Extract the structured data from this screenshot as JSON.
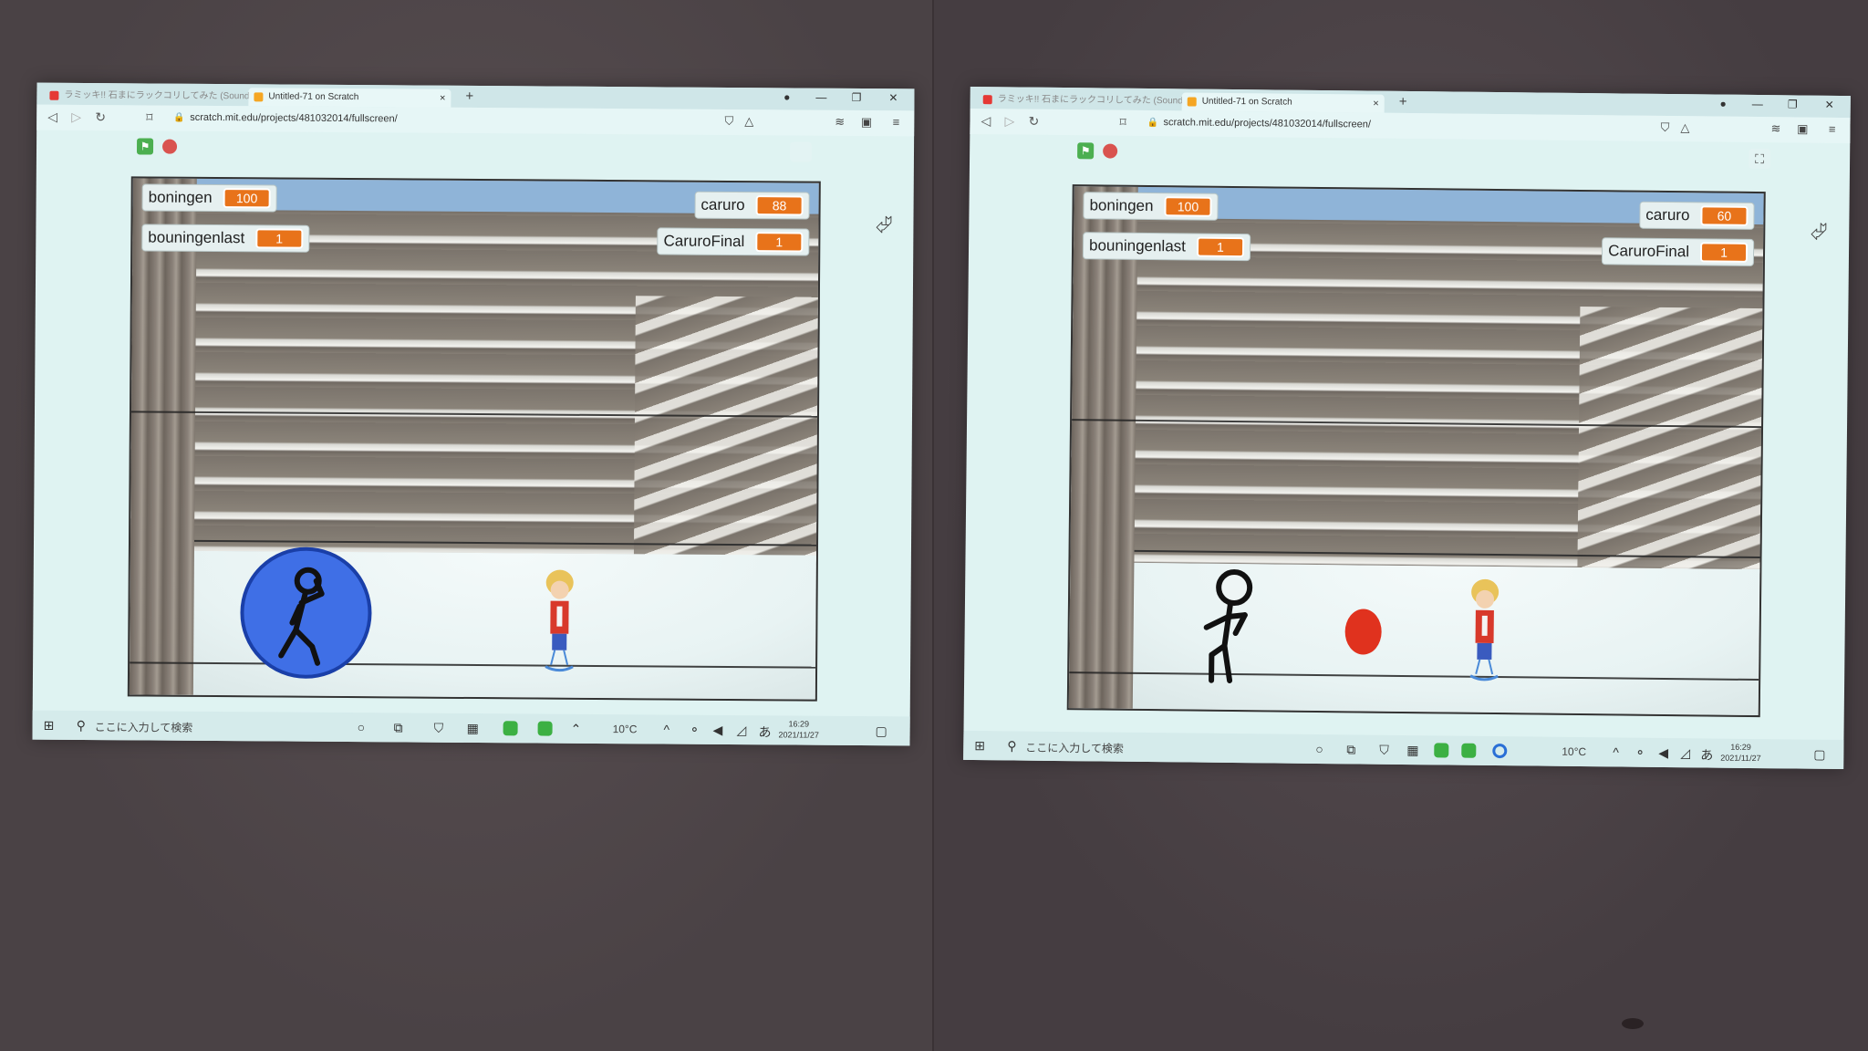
{
  "panels": [
    {
      "tabs": [
        "ラミッキ!! 石まにラックコリしてみた (Sound)...",
        "Untitled-71 on Scratch"
      ],
      "new_tab": "+",
      "url": "scratch.mit.edu/projects/481032014/fullscreen/",
      "monitors": {
        "boningen": {
          "label": "boningen",
          "value": "100"
        },
        "bouningenlast": {
          "label": "bouningenlast",
          "value": "1"
        },
        "caruro": {
          "label": "caruro",
          "value": "88"
        },
        "caruroFinal": {
          "label": "CaruroFinal",
          "value": "1"
        }
      },
      "taskbar": {
        "search_placeholder": "ここに入力して検索",
        "temperature": "10°C",
        "time": "16:29",
        "date": "2021/11/27"
      },
      "stickman_in_shield": true,
      "fireball_visible": false
    },
    {
      "tabs": [
        "ラミッキ!! 石まにラックコリしてみた (Sound)...",
        "Untitled-71 on Scratch"
      ],
      "new_tab": "+",
      "url": "scratch.mit.edu/projects/481032014/fullscreen/",
      "monitors": {
        "boningen": {
          "label": "boningen",
          "value": "100"
        },
        "bouningenlast": {
          "label": "bouningenlast",
          "value": "1"
        },
        "caruro": {
          "label": "caruro",
          "value": "60"
        },
        "caruroFinal": {
          "label": "CaruroFinal",
          "value": "1"
        }
      },
      "taskbar": {
        "search_placeholder": "ここに入力して検索",
        "temperature": "10°C",
        "time": "16:29",
        "date": "2021/11/27"
      },
      "stickman_in_shield": false,
      "fireball_visible": true
    }
  ],
  "colors": {
    "monitor_value_bg": "#e8731a",
    "shield": "#3f6fe6",
    "fireball": "#e0321e",
    "flag": "#4caf50",
    "stop": "#d9534f"
  },
  "icons": [
    "green-flag-icon",
    "stop-icon",
    "fullscreen-icon",
    "back-icon",
    "forward-icon",
    "reload-icon",
    "bookmark-icon",
    "lock-icon",
    "windows-start-icon",
    "search-icon",
    "cursor-icon"
  ]
}
